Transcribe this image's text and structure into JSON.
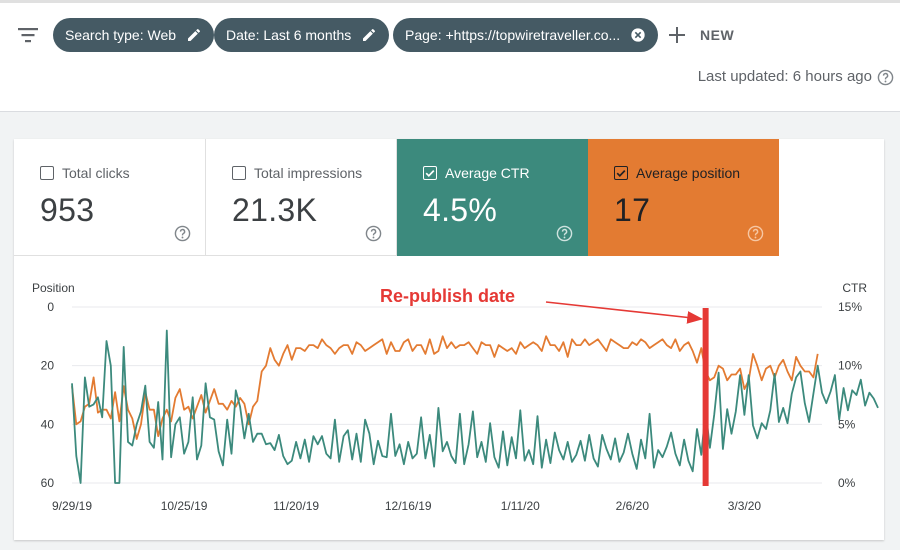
{
  "filters": {
    "chips": [
      {
        "label": "Search type: Web",
        "action": "edit"
      },
      {
        "label": "Date: Last 6 months",
        "action": "edit"
      },
      {
        "label": "Page: +https://topwiretraveller.co...",
        "action": "remove"
      }
    ],
    "new_label": "NEW",
    "last_updated": "Last updated: 6 hours ago"
  },
  "metrics": [
    {
      "label": "Total clicks",
      "value": "953",
      "checked": false
    },
    {
      "label": "Total impressions",
      "value": "21.3K",
      "checked": false
    },
    {
      "label": "Average CTR",
      "value": "4.5%",
      "checked": true,
      "color": "#3c8a7d"
    },
    {
      "label": "Average position",
      "value": "17",
      "checked": true,
      "color": "#e37b32"
    }
  ],
  "chart_data": {
    "type": "line",
    "left_axis_label": "Position",
    "right_axis_label": "CTR",
    "left_ticks": [
      "0",
      "20",
      "40",
      "60"
    ],
    "right_ticks": [
      "15%",
      "10%",
      "5%",
      "0%"
    ],
    "ylim_left": [
      0,
      60
    ],
    "ylim_right": [
      0,
      15
    ],
    "left_inverted": true,
    "x_tick_labels": [
      "9/29/19",
      "10/25/19",
      "11/20/19",
      "12/16/19",
      "1/11/20",
      "2/6/20",
      "3/3/20"
    ],
    "x_tick_days": [
      0,
      26,
      52,
      78,
      104,
      130,
      156
    ],
    "x_days_range": [
      0,
      174
    ],
    "annotation": {
      "text": "Re-publish date",
      "day": 147,
      "color": "#e53935"
    },
    "series": [
      {
        "name": "Average position",
        "color": "#e37b32",
        "axis": "left",
        "values": [
          27,
          40,
          39,
          34,
          33,
          24,
          36,
          35,
          35,
          38,
          29,
          39,
          27,
          35,
          38,
          45,
          40,
          29,
          35,
          35,
          44,
          38,
          35,
          39,
          31,
          28,
          35,
          34,
          38,
          34,
          30,
          36,
          32,
          28,
          33,
          33,
          35,
          32,
          34,
          31,
          33,
          40,
          34,
          32,
          22,
          20,
          14,
          18,
          20,
          16,
          13,
          18,
          14,
          14,
          15,
          13,
          13,
          14,
          11,
          13,
          14,
          16,
          14,
          13,
          13,
          16,
          12,
          13,
          15,
          14,
          13,
          12,
          11,
          16,
          12,
          15,
          15,
          12,
          11,
          15,
          13,
          13,
          16,
          11,
          16,
          15,
          10,
          14,
          12,
          14,
          13,
          13,
          12,
          14,
          16,
          12,
          13,
          13,
          17,
          13,
          14,
          15,
          14,
          16,
          12,
          14,
          13,
          12,
          13,
          15,
          10,
          13,
          13,
          15,
          12,
          17,
          11,
          13,
          13,
          11,
          13,
          12,
          11,
          13,
          15,
          11,
          12,
          13,
          14,
          14,
          12,
          13,
          11,
          12,
          14,
          13,
          12,
          11,
          13,
          14,
          11,
          15,
          13,
          12,
          15,
          19,
          14,
          22,
          25,
          24,
          20,
          21,
          25,
          23,
          23,
          21,
          28,
          25,
          16,
          20,
          25,
          21,
          20,
          24,
          20,
          18,
          22,
          25,
          17,
          20,
          22,
          22,
          24,
          16
        ]
      },
      {
        "name": "Average CTR",
        "color": "#3c8a7d",
        "axis": "right",
        "values": [
          8.5,
          2.3,
          0.0,
          9.0,
          6.5,
          6.7,
          7.3,
          5.6,
          12.1,
          10.0,
          0.0,
          0.0,
          11.6,
          3.5,
          3.2,
          5.0,
          6.1,
          8.3,
          3.5,
          3.0,
          6.9,
          2.0,
          13.0,
          2.2,
          5.0,
          5.6,
          2.5,
          3.5,
          7.3,
          2.0,
          3.2,
          8.5,
          5.6,
          5.4,
          2.7,
          1.5,
          5.4,
          2.5,
          7.9,
          6.5,
          3.8,
          5.9,
          3.5,
          4.2,
          4.2,
          3.3,
          3.4,
          2.8,
          4.1,
          2.3,
          1.6,
          1.9,
          3.5,
          2.1,
          3.7,
          1.8,
          4.0,
          3.3,
          4.0,
          2.5,
          2.1,
          5.4,
          1.8,
          4.0,
          4.5,
          2.0,
          4.2,
          1.8,
          5.4,
          4.2,
          1.6,
          3.6,
          2.3,
          2.2,
          5.9,
          2.3,
          3.3,
          1.6,
          3.5,
          2.1,
          2.5,
          5.6,
          2.1,
          4.1,
          1.4,
          6.4,
          2.7,
          3.5,
          2.3,
          1.7,
          5.9,
          1.6,
          3.3,
          6.1,
          2.2,
          3.5,
          1.8,
          5.1,
          2.2,
          1.3,
          4.4,
          1.5,
          3.9,
          2.1,
          6.2,
          1.9,
          2.8,
          1.6,
          5.7,
          1.3,
          3.7,
          1.7,
          4.3,
          2.8,
          2.0,
          3.5,
          1.8,
          2.4,
          3.6,
          1.9,
          4.1,
          2.1,
          1.4,
          4.1,
          2.9,
          2.0,
          3.8,
          1.8,
          2.6,
          4.2,
          2.5,
          1.2,
          3.7,
          2.1,
          5.9,
          1.3,
          2.8,
          2.2,
          3.1,
          4.3,
          2.5,
          1.5,
          3.7,
          1.9,
          1.0,
          4.6,
          2.4,
          6.2,
          3.0,
          5.8,
          9.4,
          2.9,
          6.3,
          4.2,
          6.1,
          9.2,
          5.8,
          9.2,
          4.9,
          3.8,
          5.1,
          4.6,
          6.2,
          9.3,
          5.2,
          6.4,
          5.1,
          7.6,
          9.0,
          9.5,
          6.8,
          5.2,
          7.6,
          10.0,
          7.7,
          6.8,
          7.8,
          9.2,
          5.4,
          8.1,
          6.2,
          7.9,
          7.5,
          8.8,
          6.6,
          7.7,
          7.2,
          6.4
        ]
      }
    ]
  }
}
